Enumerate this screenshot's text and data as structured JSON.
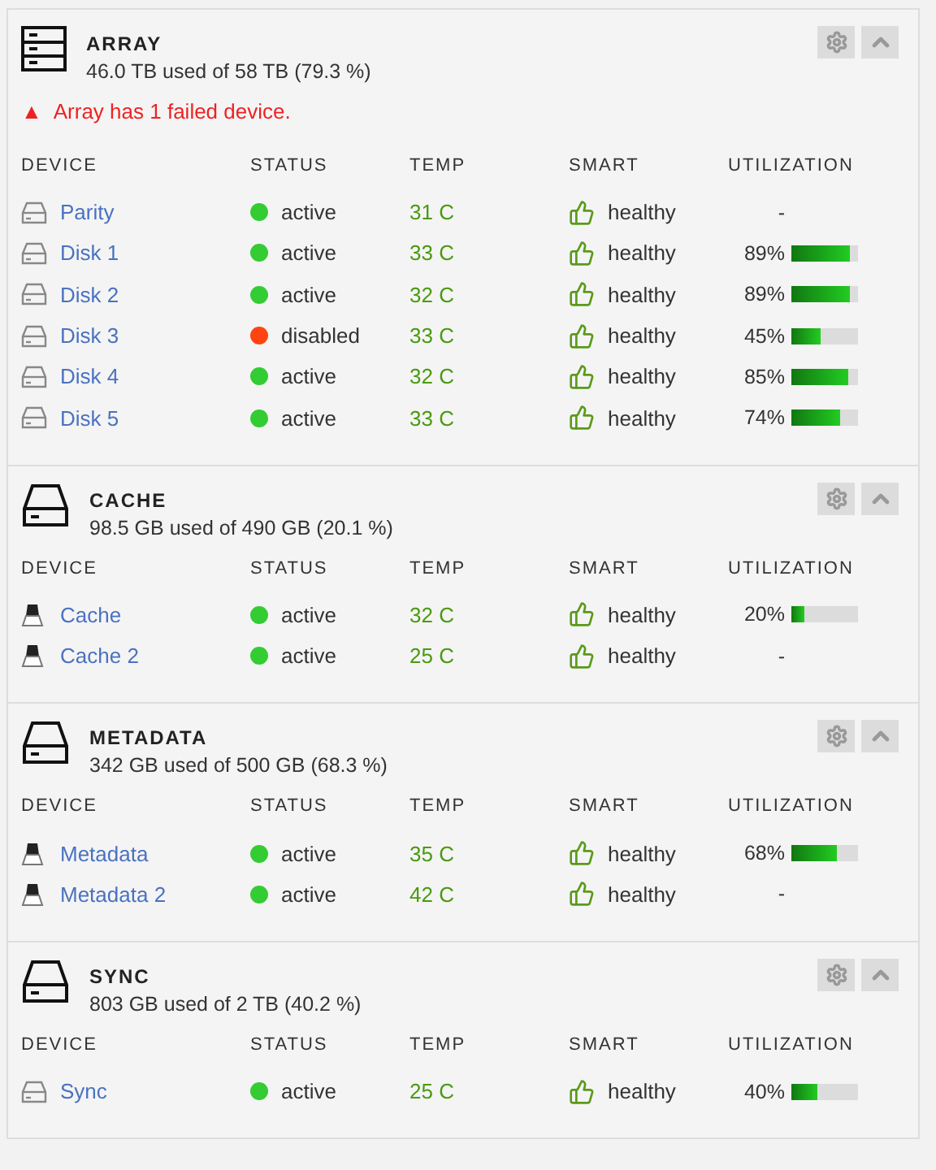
{
  "sections": [
    {
      "kind": "array",
      "title": "ARRAY",
      "usage": "46.0 TB used of 58 TB (79.3 %)",
      "alert": {
        "icon": "▲",
        "text": "Array has 1 failed device."
      },
      "columns": [
        "DEVICE",
        "STATUS",
        "TEMP",
        "SMART",
        "UTILIZATION"
      ],
      "devices": [
        {
          "kind": "hdd",
          "name": "Parity",
          "status": "active",
          "color": "#33cc33",
          "temp": "31 C",
          "smart": "healthy",
          "utilization": "-"
        },
        {
          "kind": "hdd",
          "name": "Disk 1",
          "status": "active",
          "color": "#33cc33",
          "temp": "33 C",
          "smart": "healthy",
          "utilization": "89%",
          "level": 0.89
        },
        {
          "kind": "hdd",
          "name": "Disk 2",
          "status": "active",
          "color": "#33cc33",
          "temp": "32 C",
          "smart": "healthy",
          "utilization": "89%",
          "level": 0.89
        },
        {
          "kind": "hdd",
          "name": "Disk 3",
          "status": "disabled",
          "color": "#ff4411",
          "temp": "33 C",
          "smart": "healthy",
          "utilization": "45%",
          "level": 0.45
        },
        {
          "kind": "hdd",
          "name": "Disk 4",
          "status": "active",
          "color": "#33cc33",
          "temp": "32 C",
          "smart": "healthy",
          "utilization": "85%",
          "level": 0.85
        },
        {
          "kind": "hdd",
          "name": "Disk 5",
          "status": "active",
          "color": "#33cc33",
          "temp": "33 C",
          "smart": "healthy",
          "utilization": "74%",
          "level": 0.74
        }
      ]
    },
    {
      "kind": "drive",
      "title": "CACHE",
      "usage": "98.5 GB used of 490 GB (20.1 %)",
      "columns": [
        "DEVICE",
        "STATUS",
        "TEMP",
        "SMART",
        "UTILIZATION"
      ],
      "devices": [
        {
          "kind": "ssd",
          "name": "Cache",
          "status": "active",
          "color": "#33cc33",
          "temp": "32 C",
          "smart": "healthy",
          "utilization": "20%",
          "level": 0.2
        },
        {
          "kind": "ssd",
          "name": "Cache 2",
          "status": "active",
          "color": "#33cc33",
          "temp": "25 C",
          "smart": "healthy",
          "utilization": "-"
        }
      ]
    },
    {
      "kind": "drive",
      "title": "METADATA",
      "usage": "342 GB used of 500 GB (68.3 %)",
      "columns": [
        "DEVICE",
        "STATUS",
        "TEMP",
        "SMART",
        "UTILIZATION"
      ],
      "devices": [
        {
          "kind": "ssd",
          "name": "Metadata",
          "status": "active",
          "color": "#33cc33",
          "temp": "35 C",
          "smart": "healthy",
          "utilization": "68%",
          "level": 0.68
        },
        {
          "kind": "ssd",
          "name": "Metadata 2",
          "status": "active",
          "color": "#33cc33",
          "temp": "42 C",
          "smart": "healthy",
          "utilization": "-"
        }
      ]
    },
    {
      "kind": "drive",
      "title": "SYNC",
      "usage": "803 GB used of 2 TB (40.2 %)",
      "columns": [
        "DEVICE",
        "STATUS",
        "TEMP",
        "SMART",
        "UTILIZATION"
      ],
      "devices": [
        {
          "kind": "hdd",
          "name": "Sync",
          "status": "active",
          "color": "#33cc33",
          "temp": "25 C",
          "smart": "healthy",
          "utilization": "40%",
          "level": 0.4
        }
      ]
    }
  ]
}
